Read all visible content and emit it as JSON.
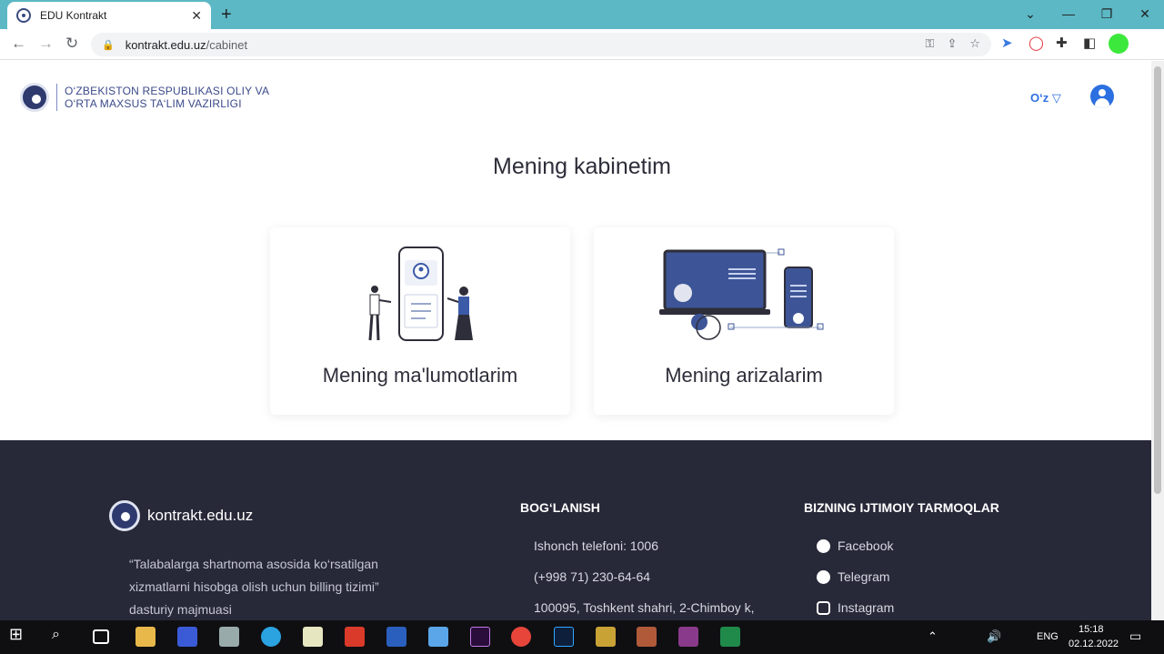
{
  "browser": {
    "tab_title": "EDU Kontrakt",
    "url_host": "kontrakt.edu.uz",
    "url_path": "/cabinet"
  },
  "header": {
    "ministry_line1": "O‘ZBEKISTON RESPUBLIKASI OLIY VA",
    "ministry_line2": "O‘RTA MAXSUS TA‘LIM VAZIRLIGI",
    "language": "O‘z"
  },
  "main": {
    "title": "Mening kabinetim",
    "cards": [
      {
        "label": "Mening ma'lumotlarim",
        "icon": "profile-phone-illustration"
      },
      {
        "label": "Mening arizalarim",
        "icon": "devices-illustration"
      }
    ]
  },
  "footer": {
    "site_name": "kontrakt.edu.uz",
    "description": "“Talabalarga shartnoma asosida ko‘rsatilgan xizmatlarni hisobga olish uchun billing tizimi” dasturiy majmuasi",
    "contact": {
      "heading": "BOG‘LANISH",
      "items": [
        "Ishonch telefoni: 1006",
        "(+998 71) 230-64-64",
        "100095, Toshkent shahri, 2-Chimboy k,"
      ]
    },
    "social": {
      "heading": "BIZNING IJTIMOIY TARMOQLAR",
      "items": [
        "Facebook",
        "Telegram",
        "Instagram"
      ]
    }
  },
  "taskbar": {
    "language": "ENG",
    "time": "15:18",
    "date": "02.12.2022"
  },
  "colors": {
    "accent": "#2b6fe0",
    "footer_bg": "#272838",
    "chrome_bg": "#5bb8c4"
  }
}
